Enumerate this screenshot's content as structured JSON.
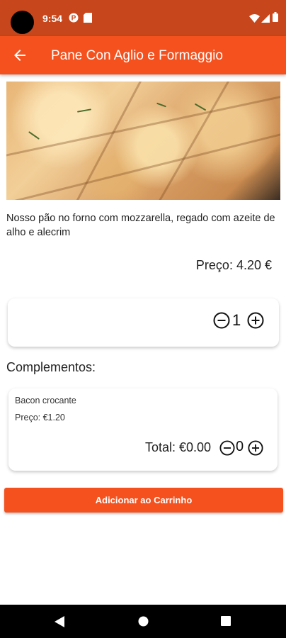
{
  "status_bar": {
    "time": "9:54",
    "icons": [
      "camera-cutout",
      "pinterest-icon",
      "sd-card-icon",
      "wifi-icon",
      "signal-icon",
      "battery-icon"
    ]
  },
  "app_bar": {
    "back_icon": "arrow-back-icon",
    "title": "Pane Con Aglio e Formaggio"
  },
  "product": {
    "description": "Nosso pão no forno com mozzarella, regado com azeite de alho e alecrim",
    "price_label": "Preço: 4.20 €",
    "quantity": "1"
  },
  "complements": {
    "heading": "Complementos:",
    "items": [
      {
        "name": "Bacon crocante",
        "price": "Preço: €1.20",
        "total": "Total: €0.00",
        "quantity": "0"
      }
    ]
  },
  "cta": {
    "label": "Adicionar ao Carrinho"
  },
  "colors": {
    "status_bar": "#c7461b",
    "accent": "#f4511e"
  },
  "nav_bar": {
    "icons": [
      "back-triangle-icon",
      "home-circle-icon",
      "recents-square-icon"
    ]
  }
}
